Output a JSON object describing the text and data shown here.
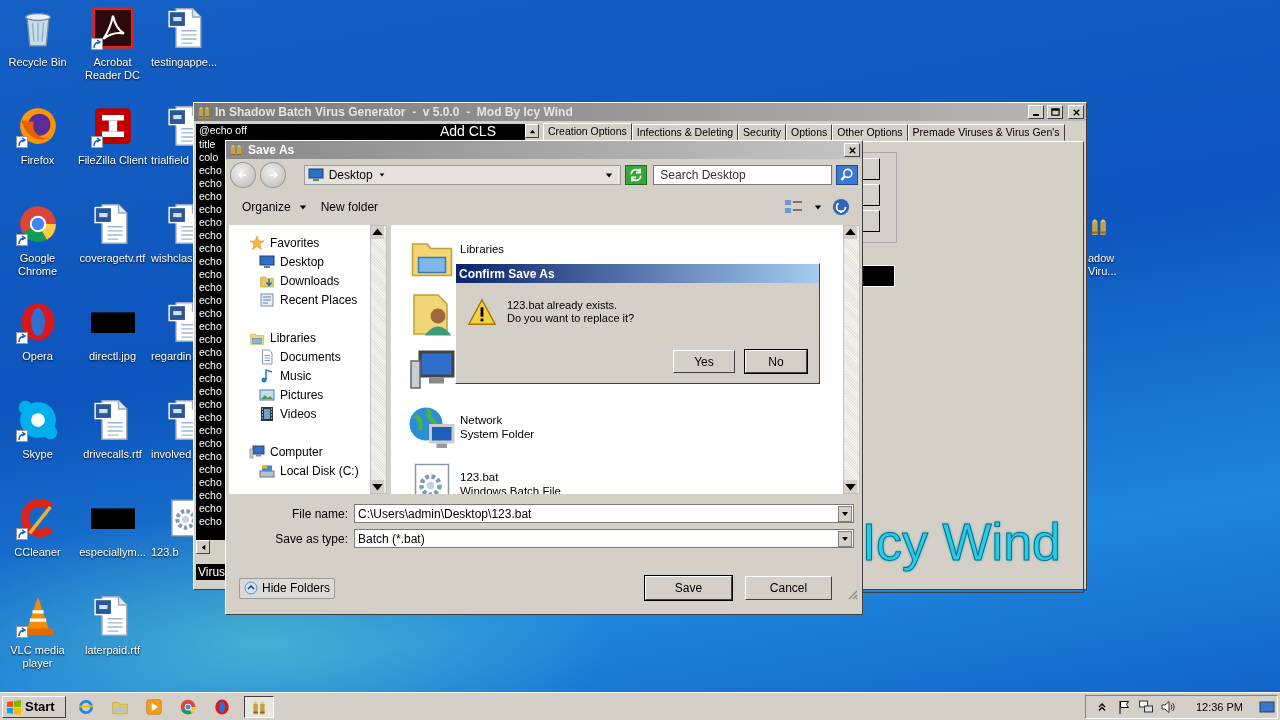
{
  "desktop": {
    "icons": [
      {
        "label": "Recycle Bin",
        "kind": "recycle",
        "shortcut": false
      },
      {
        "label": "Firefox",
        "kind": "firefox",
        "shortcut": true
      },
      {
        "label": "Google Chrome",
        "kind": "chrome",
        "shortcut": true
      },
      {
        "label": "Opera",
        "kind": "opera",
        "shortcut": true
      },
      {
        "label": "Skype",
        "kind": "skype",
        "shortcut": true
      },
      {
        "label": "CCleaner",
        "kind": "ccleaner",
        "shortcut": true
      },
      {
        "label": "VLC media player",
        "kind": "vlc",
        "shortcut": true
      },
      {
        "label": "Acrobat Reader DC",
        "kind": "acrobat",
        "shortcut": true
      },
      {
        "label": "FileZilla Client",
        "kind": "filezilla",
        "shortcut": true
      },
      {
        "label": "coveragetv.rtf",
        "kind": "word",
        "shortcut": false
      },
      {
        "label": "directl.jpg",
        "kind": "blackimg",
        "shortcut": false
      },
      {
        "label": "drivecalls.rtf",
        "kind": "word",
        "shortcut": false
      },
      {
        "label": "especiallym...",
        "kind": "blackimg",
        "shortcut": false
      },
      {
        "label": "laterpaid.rtf",
        "kind": "word",
        "shortcut": false
      },
      {
        "label": "testingappe...",
        "kind": "word",
        "shortcut": false
      },
      {
        "label": "trialfield",
        "kind": "word",
        "shortcut": false
      },
      {
        "label": "wishclas",
        "kind": "word",
        "shortcut": false
      },
      {
        "label": "regardin",
        "kind": "word",
        "shortcut": false
      },
      {
        "label": "involved",
        "kind": "word",
        "shortcut": false
      },
      {
        "label": "123.b",
        "kind": "batch",
        "shortcut": false
      }
    ],
    "side_icon": {
      "kind": "app",
      "label_lines": [
        "adow",
        "Viru..."
      ]
    }
  },
  "app_window": {
    "title": "In Shadow Batch Virus Generator  -  v 5.0.0  -  Mod By Icy Wind",
    "code_lines": [
      "@echo off",
      "title",
      "colo",
      "echo",
      "echo",
      "echo",
      "echo",
      "echo",
      "echo",
      "echo",
      "echo",
      "echo",
      "echo",
      "echo",
      "echo",
      "echo",
      "echo",
      "echo",
      "echo",
      "echo",
      "echo",
      "echo",
      "echo",
      "echo",
      "echo",
      "echo",
      "echo",
      "echo",
      "echo",
      "echo",
      "echo"
    ],
    "add_button": "Add CLS",
    "status": "Virus",
    "tabs": [
      {
        "label": "Creation Options",
        "selected": true
      },
      {
        "label": "Infections & Deleting",
        "selected": false
      },
      {
        "label": "Security",
        "selected": false
      },
      {
        "label": "Options",
        "selected": false
      },
      {
        "label": "Other Options",
        "selected": false
      },
      {
        "label": "Premade Viruses & Virus Gen's",
        "selected": false
      }
    ],
    "logo": "Icy Wind"
  },
  "save_dialog": {
    "title": "Save As",
    "location": "Desktop",
    "search_placeholder": "Search Desktop",
    "organize": "Organize",
    "new_folder": "New folder",
    "nav": [
      {
        "label": "Favorites",
        "kind": "star",
        "children": [
          {
            "label": "Desktop",
            "kind": "desktop"
          },
          {
            "label": "Downloads",
            "kind": "downloads"
          },
          {
            "label": "Recent Places",
            "kind": "recent"
          }
        ]
      },
      {
        "label": "Libraries",
        "kind": "libraries",
        "children": [
          {
            "label": "Documents",
            "kind": "documents"
          },
          {
            "label": "Music",
            "kind": "music"
          },
          {
            "label": "Pictures",
            "kind": "pictures"
          },
          {
            "label": "Videos",
            "kind": "videos"
          }
        ]
      },
      {
        "label": "Computer",
        "kind": "computer",
        "children": [
          {
            "label": "Local Disk (C:)",
            "kind": "disk"
          }
        ]
      }
    ],
    "files": [
      {
        "kind": "libraries",
        "lines": [
          "Libraries"
        ]
      },
      {
        "kind": "userfolder"
      },
      {
        "kind": "computer"
      },
      {
        "kind": "network",
        "lines": [
          "Network",
          "System Folder"
        ]
      },
      {
        "kind": "batch",
        "lines": [
          "123.bat",
          "Windows Batch File"
        ]
      }
    ],
    "file_name_label": "File name:",
    "file_name": "C:\\Users\\admin\\Desktop\\123.bat",
    "type_label": "Save as type:",
    "type": "Batch (*.bat)",
    "hide_folders": "Hide Folders",
    "buttons": [
      {
        "label": "Save",
        "default": true
      },
      {
        "label": "Cancel",
        "default": false
      }
    ]
  },
  "confirm": {
    "title": "Confirm Save As",
    "message_lines": [
      "123.bat already exists.",
      "Do you want to replace it?"
    ],
    "buttons": [
      {
        "label": "Yes",
        "default": false
      },
      {
        "label": "No",
        "default": true
      }
    ]
  },
  "taskbar": {
    "start": "Start",
    "apps": [
      {
        "kind": "ie",
        "active": false
      },
      {
        "kind": "explorer",
        "active": false
      },
      {
        "kind": "media",
        "active": false
      },
      {
        "kind": "chrome",
        "active": false
      },
      {
        "kind": "opera",
        "active": false
      },
      {
        "kind": "app",
        "active": true
      }
    ],
    "clock": "12:36 PM"
  }
}
